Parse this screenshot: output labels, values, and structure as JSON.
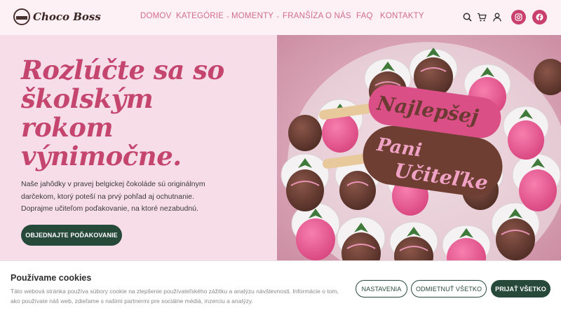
{
  "header": {
    "brand": "Choco Boss",
    "nav": [
      {
        "label": "DOMOV",
        "dropdown": false
      },
      {
        "label": "KATEGÓRIE",
        "dropdown": true
      },
      {
        "label": "MOMENTY",
        "dropdown": true
      },
      {
        "label": "FRANŠÍZA",
        "dropdown": false
      },
      {
        "label": "O NÁS",
        "dropdown": false
      },
      {
        "label": "FAQ",
        "dropdown": false
      },
      {
        "label": "KONTAKTY",
        "dropdown": false
      }
    ],
    "icons": [
      "search-icon",
      "cart-icon",
      "account-icon",
      "instagram-icon",
      "facebook-icon"
    ]
  },
  "hero": {
    "title_lines": [
      "Rozlúčte sa so",
      "školským",
      "rokom",
      "výnimočne."
    ],
    "text_lines": [
      "Naše jahôdky v pravej belgickej čokoláde sú originálnym",
      "darčekom, ktorý poteší na prvý pohľad aj ochutnanie.",
      "Doprajme učiteľom poďakovanie, na ktoré nezabudnú."
    ],
    "cta": "OBJEDNAJTE POĎAKOVANIE",
    "image": {
      "popsicle_1": "Najlepšej",
      "popsicle_2_line1": "Pani",
      "popsicle_2_line2": "Učiteľke"
    }
  },
  "cookie": {
    "title": "Používame cookies",
    "text_lines": [
      "Táto webová stránka používa súbory cookie na zlepšenie používateľského zážitku a analýzu návštevnosti. Informácie o tom,",
      "ako používate náš web, zdieľame s našimi partnermi pre sociálne médiá, inzerciu a analýzy."
    ],
    "buttons": {
      "settings": "NASTAVENIA",
      "reject": "ODMIETNUŤ VŠETKO",
      "accept": "PRIJAŤ VŠETKO"
    }
  },
  "colors": {
    "accent_pink": "#c4466f",
    "nav_pink": "#d16c8b",
    "brand_green": "#27493a",
    "hero_bg": "#f6dde8",
    "page_bg": "#fdf1f6"
  }
}
